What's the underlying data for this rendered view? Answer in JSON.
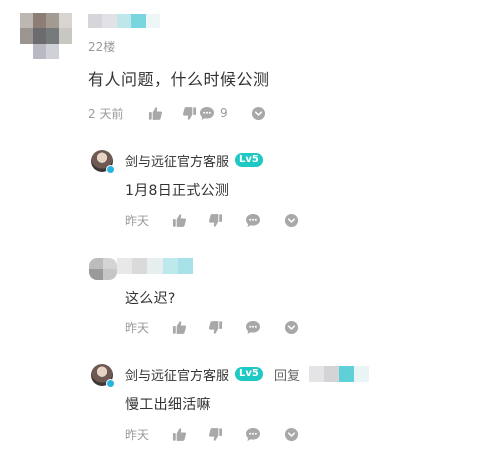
{
  "main_comment": {
    "floor": "22楼",
    "text": "有人问题，什么时候公测",
    "time": "2 天前",
    "reply_count": "9"
  },
  "replies": [
    {
      "author": "剑与远征官方客服",
      "level": "Lv5",
      "text": "1月8日正式公测",
      "time": "昨天"
    },
    {
      "author": "",
      "level": "",
      "text": "这么迟?",
      "time": "昨天"
    },
    {
      "author": "剑与远征官方客服",
      "level": "Lv5",
      "reply_prefix": "回复",
      "text": "慢工出细活嘛",
      "time": "昨天"
    }
  ],
  "icons": [
    "thumbs-up-icon",
    "thumbs-down-icon",
    "comment-bubble-icon",
    "more-chevron-icon"
  ],
  "colors": {
    "level_badge": "#1ec8c3",
    "verified": "#28b4e0",
    "icon": "#a8a8a8",
    "muted_text": "#9a9a9a"
  }
}
